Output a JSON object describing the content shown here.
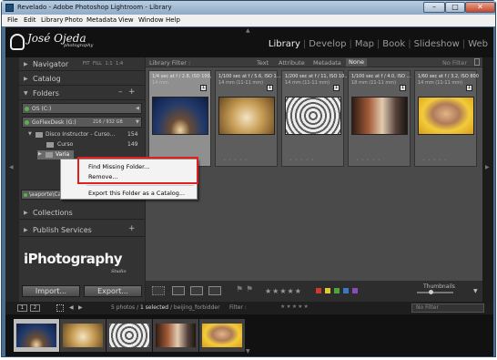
{
  "window": {
    "title": "Revelado - Adobe Photoshop Lightroom - Library",
    "min_label": "–",
    "max_label": "□",
    "close_label": "✕"
  },
  "menu": [
    "File",
    "Edit",
    "Library",
    "Photo",
    "Metadata",
    "View",
    "Window",
    "Help"
  ],
  "header": {
    "logo_name": "José Ojeda",
    "logo_sub": "photography",
    "modules": [
      "Library",
      "Develop",
      "Map",
      "Book",
      "Slideshow",
      "Web"
    ]
  },
  "left_panel": {
    "navigator": {
      "label": "Navigator",
      "options": "FIT FILL 1:1 1:4"
    },
    "catalog": {
      "label": "Catalog"
    },
    "folders": {
      "label": "Folders",
      "add": "+",
      "minus": "–",
      "volumes": [
        {
          "name": "OS (C:)",
          "size": ""
        },
        {
          "name": "GoFlexDesk (G:)",
          "size": "216 / 932 GB"
        }
      ],
      "items": [
        {
          "name": "Disco Instructor - Curso...",
          "count": "154"
        },
        {
          "name": "Curso",
          "count": "149"
        },
        {
          "name": "Varia",
          "count": ""
        }
      ],
      "usb_label": "\\aaporte\\Carp"
    },
    "collections": {
      "label": "Collections"
    },
    "publish": {
      "label": "Publish Services"
    },
    "brand_main": "iPhotography",
    "brand_sub": "Studio",
    "import_label": "Import...",
    "export_label": "Export..."
  },
  "context_menu": {
    "items": [
      "Find Missing Folder...",
      "Remove...",
      "Export this Folder as a Catalog..."
    ]
  },
  "filter_bar": {
    "label": "Library Filter :",
    "tabs": [
      "Text",
      "Attribute",
      "Metadata",
      "None"
    ],
    "no_filter": "No Filter"
  },
  "grid": {
    "cells": [
      {
        "exposure": "1/4 sec at f / 2.8, ISO 100,",
        "lens": "14 mm",
        "num": "1"
      },
      {
        "exposure": "1/100 sec at f / 5.6, ISO 1...",
        "lens": "14 mm (11-11 mm)",
        "num": "1"
      },
      {
        "exposure": "1/200 sec at f / 11, ISO 10...",
        "lens": "14 mm (11-11 mm)",
        "num": "1"
      },
      {
        "exposure": "1/100 sec at f / 4.0, ISO ...",
        "lens": "18 mm (11-11 mm)",
        "num": "1"
      },
      {
        "exposure": "1/60 sec at f / 3.2, ISO 800",
        "lens": "14 mm (11-11 mm)",
        "num": "1"
      }
    ]
  },
  "toolbar": {
    "stars": "★★★★★",
    "thumbnails_label": "Thumbnails",
    "colors": [
      "#d03a2e",
      "#e0c830",
      "#4aa740",
      "#3a78c8",
      "#8a4ab8"
    ]
  },
  "filmstrip": {
    "page1": "1",
    "page2": "2",
    "info_prefix": "5 photos /",
    "info_selected": "1 selected",
    "info_suffix": "/ beijing_forbidder",
    "filter_label": "Filter :",
    "stars": "★★★★★",
    "no_filter": "No Filter"
  }
}
